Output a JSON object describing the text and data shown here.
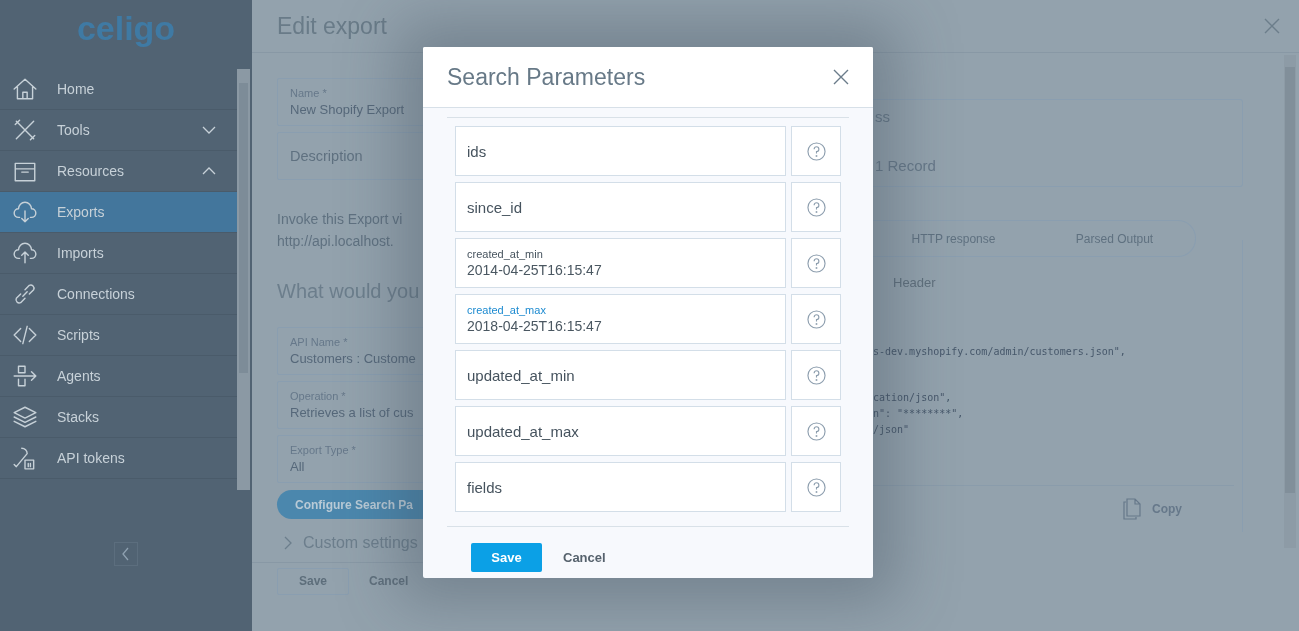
{
  "sidebar": {
    "logo": "celigo",
    "items": [
      {
        "label": "Home",
        "selected": false
      },
      {
        "label": "Tools",
        "selected": false,
        "expanded": false
      },
      {
        "label": "Resources",
        "selected": false,
        "expanded": true
      },
      {
        "label": "Exports",
        "selected": true
      },
      {
        "label": "Imports",
        "selected": false
      },
      {
        "label": "Connections",
        "selected": false
      },
      {
        "label": "Scripts",
        "selected": false
      },
      {
        "label": "Agents",
        "selected": false
      },
      {
        "label": "Stacks",
        "selected": false
      },
      {
        "label": "API tokens",
        "selected": false
      }
    ]
  },
  "drawer": {
    "title": "Edit export",
    "top_fields": [
      {
        "label": "Name *",
        "value": "New Shopify Export"
      },
      {
        "placeholder": "Description"
      }
    ],
    "invoke_text": [
      "Invoke this Export vi",
      "http://api.localhost."
    ],
    "section_heading": "What would you",
    "fields": [
      {
        "label": "API Name *",
        "value": "Customers : Custome"
      },
      {
        "label": "Operation *",
        "value": "Retrieves a list of cus"
      },
      {
        "label": "Export Type *",
        "value": "All"
      }
    ],
    "configure_button": "Configure Search Pa",
    "custom_settings": "Custom settings",
    "footer": {
      "save": {
        "label": "Save",
        "disabled": true
      },
      "cancel": "Cancel"
    },
    "preview": {
      "status": [
        "ss",
        "1 Record"
      ],
      "tabs": [
        {
          "label": "HTTP response"
        },
        {
          "label": "Parsed Output"
        }
      ],
      "sub_tab": "Header",
      "code_lines": [
        {
          "text": "s-dev.myshopify.com/admin/customers.json\","
        },
        {
          "text": "cation/json\","
        },
        {
          "text": "n\": \"********\","
        },
        {
          "text": "/json\""
        }
      ],
      "copy": "Copy"
    }
  },
  "modal": {
    "title": "Search Parameters",
    "params": [
      {
        "label": "ids",
        "focused": false
      },
      {
        "label": "since_id",
        "focused": false
      },
      {
        "label": "created_at_min",
        "value": "2014-04-25T16:15:47",
        "focused": false
      },
      {
        "label": "created_at_max",
        "value": "2018-04-25T16:15:47",
        "focused": true
      },
      {
        "label": "updated_at_min",
        "focused": false
      },
      {
        "label": "updated_at_max",
        "focused": false
      },
      {
        "label": "fields",
        "focused": false
      }
    ],
    "save": "Save",
    "cancel": "Cancel"
  }
}
